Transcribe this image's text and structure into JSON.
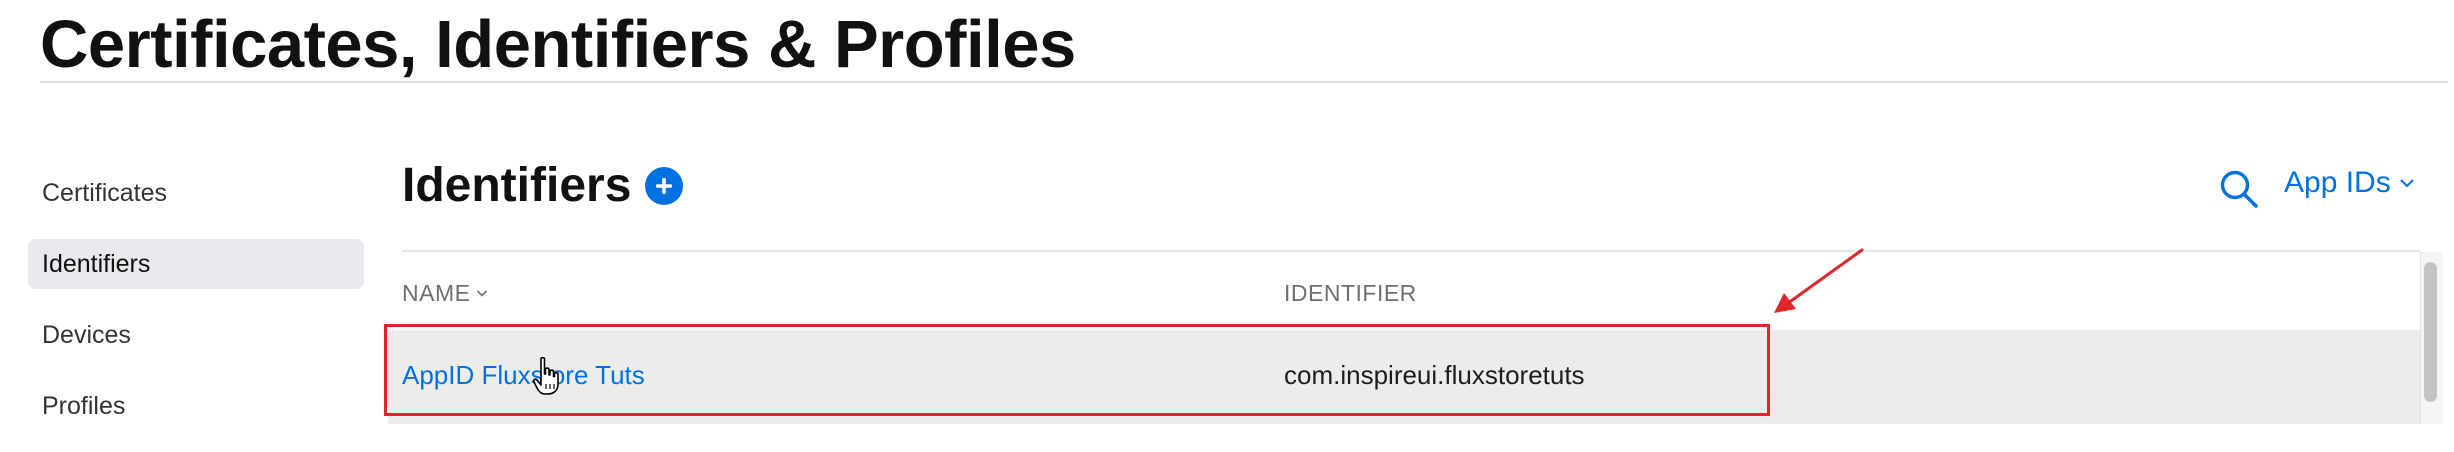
{
  "header": {
    "title": "Certificates, Identifiers & Profiles"
  },
  "sidebar": {
    "items": [
      {
        "label": "Certificates",
        "active": false
      },
      {
        "label": "Identifiers",
        "active": true
      },
      {
        "label": "Devices",
        "active": false
      },
      {
        "label": "Profiles",
        "active": false
      }
    ]
  },
  "main": {
    "section_title": "Identifiers",
    "add_icon": "plus-circle-icon",
    "search_icon": "search-icon",
    "filter": {
      "selected": "App IDs",
      "icon": "chevron-down-icon"
    },
    "table": {
      "columns": [
        {
          "label": "NAME",
          "sortable": true
        },
        {
          "label": "IDENTIFIER",
          "sortable": false
        }
      ],
      "rows": [
        {
          "name": "AppID Fluxstore Tuts",
          "identifier": "com.inspireui.fluxstoretuts"
        }
      ]
    }
  },
  "annotation": {
    "highlight_color": "#e0262b",
    "arrow_color": "#e0262b"
  },
  "colors": {
    "accent": "#0071e3",
    "sidebar_active_bg": "#e8e8ed",
    "row_hover_bg": "#ececec"
  }
}
